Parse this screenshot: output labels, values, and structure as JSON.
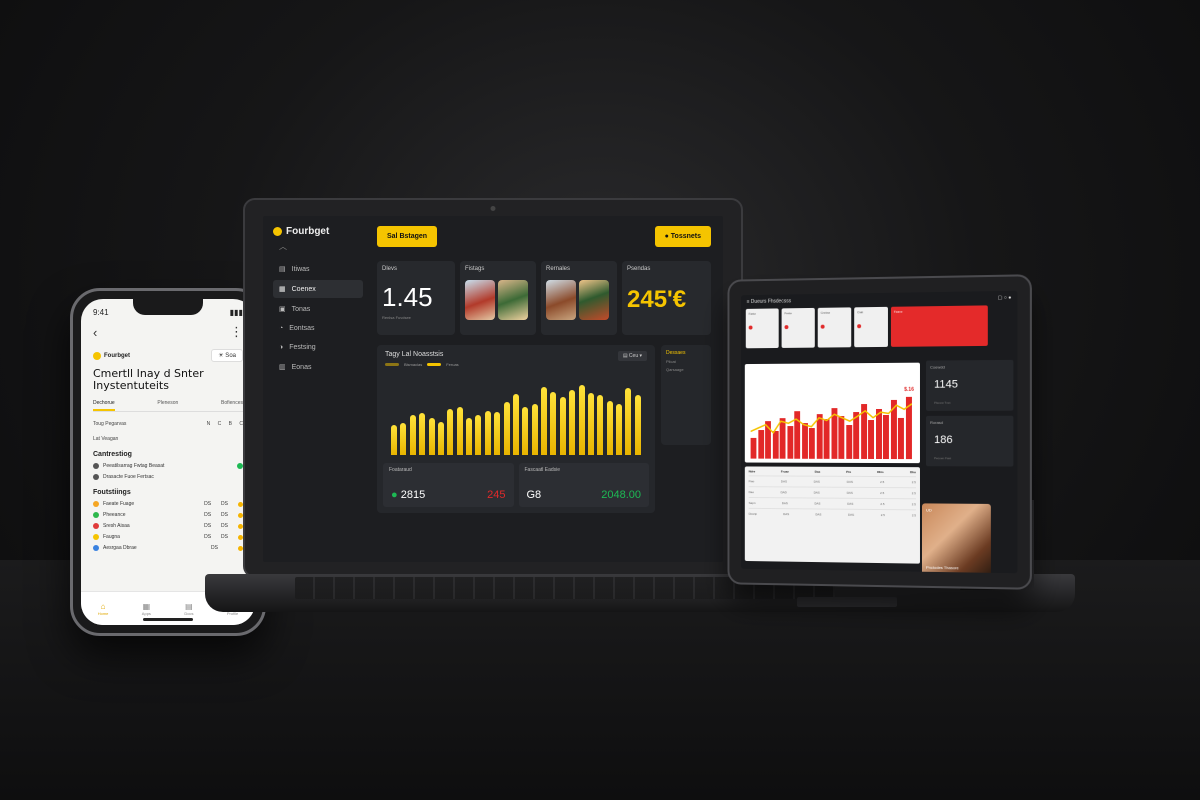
{
  "phone": {
    "status_time": "9:41",
    "back_icon": "chevron-left-icon",
    "menu_icon": "more-vertical-icon",
    "brand": "Fourbget",
    "chip": "☀ Soa",
    "title_line1": "Cmertll Inay d Snter",
    "title_line2": "Inystentuteits",
    "tabs": [
      "Dechorue",
      "Pleneson",
      "Bofiences"
    ],
    "row1_label": "Toug Pegarvas",
    "row1_icons": [
      "N",
      "C",
      "B",
      "C"
    ],
    "row2_label": "Lat  Veagan",
    "section1": "Cantrestiog",
    "section1_items": [
      {
        "label": "Peeatilsarrag  Fwtag  Beasat",
        "value": ""
      },
      {
        "label": "Drasacte  Fuoe  Fertsac",
        "value": ""
      }
    ],
    "section2": "Foutstiings",
    "section2_items": [
      {
        "label": "Faeate  Fuage",
        "v1": "DS",
        "v2": "DS",
        "color": "#f5a623"
      },
      {
        "label": "Pheeance",
        "v1": "DS",
        "v2": "DS",
        "color": "#2eb84c"
      },
      {
        "label": "Sresh  Aisaa",
        "v1": "DS",
        "v2": "DS",
        "color": "#e03a3a"
      },
      {
        "label": "Faugna",
        "v1": "DS",
        "v2": "DS",
        "color": "#f5c400"
      },
      {
        "label": "Aesrgaa  Dbrae",
        "v1": "DS",
        "v2": "",
        "color": "#3a82e0"
      }
    ],
    "bottom_nav": [
      {
        "icon": "⌂",
        "label": "Home"
      },
      {
        "icon": "▦",
        "label": "Apps"
      },
      {
        "icon": "▤",
        "label": "Docs"
      },
      {
        "icon": "♙",
        "label": "Profile"
      }
    ]
  },
  "laptop": {
    "brand": "Fourbget",
    "nav": [
      {
        "icon": "▤",
        "label": "Itiwas"
      },
      {
        "icon": "▦",
        "label": "Coenex"
      },
      {
        "icon": "▣",
        "label": "Tonas"
      },
      {
        "icon": "◔",
        "label": "Eontsas"
      },
      {
        "icon": "◑",
        "label": "Festsing"
      },
      {
        "icon": "▥",
        "label": "Eonas"
      }
    ],
    "btn_left": "Sal Bstagen",
    "btn_right": "● Tossnets",
    "card1": {
      "label": "Dlevs",
      "value": "1.45",
      "sub": "Renlsa   Fuvdsee"
    },
    "card2": {
      "label": "Fistags"
    },
    "card3": {
      "label": "Rernales"
    },
    "card4": {
      "label": "Psendas",
      "value": "245'€"
    },
    "chart_title": "Tagy Lal Noasstsis",
    "legend": [
      "Blsmacias",
      "Feruas"
    ],
    "dropdown": "▤ Ceu ▾",
    "side_panel": {
      "label": "Dessaes",
      "line1": "Plicat",
      "line2": "Qarsaage"
    },
    "stats": [
      {
        "label": "Foataraud",
        "value": "2815",
        "extra": "245",
        "color": "#1db954",
        "extra_color": "#e02a2a"
      },
      {
        "label": "Fascaatl Eadsie",
        "value": "G8",
        "extra": "2048.00",
        "color": "#ffffff",
        "extra_color": "#1db954"
      }
    ]
  },
  "laptop_chart": {
    "type": "bar",
    "values": [
      34,
      36,
      46,
      48,
      42,
      38,
      52,
      55,
      42,
      46,
      50,
      49,
      60,
      70,
      55,
      58,
      78,
      72,
      66,
      74,
      80,
      71,
      68,
      62,
      58,
      76,
      69
    ]
  },
  "tablet": {
    "header_left": "≡  Dueurs  Fhsdecsss",
    "header_right": "▢ ○ ●",
    "cards": [
      "Faste",
      "Feste",
      "Crettse",
      "Cialt"
    ],
    "red_card": "Feane",
    "chart_label": "$.16",
    "metric1": {
      "label": "Coewdd",
      "value": "1145",
      "sub": "Plsecw  Tnet"
    },
    "metric2": {
      "label": "Rorasd",
      "value": "186",
      "sub": "Pecoen  Fast"
    },
    "table_head": [
      "Ndre",
      "Fruae",
      "Daa",
      "Pra",
      "Dhis",
      "Dhu"
    ],
    "table_rows": [
      [
        "Fiao",
        "DAS",
        "DAS",
        "DAS",
        "2.5",
        "2.5"
      ],
      [
        "Dao",
        "DAD",
        "DAS",
        "DAS",
        "2.5",
        "2.5"
      ],
      [
        "Sapn",
        "DAS",
        "DAS",
        "DAS",
        "2.5",
        "2.5"
      ],
      [
        "Dcanp",
        "DAS",
        "DAS",
        "DAS",
        "2.5",
        "2.5"
      ]
    ],
    "photo_caption": "Pnctodes Thasore",
    "photo_tag": "UD"
  },
  "tablet_chart": {
    "type": "bar",
    "values": [
      30,
      42,
      55,
      40,
      60,
      48,
      70,
      52,
      45,
      66,
      58,
      74,
      62,
      50,
      68,
      80,
      56,
      72,
      64,
      85,
      60,
      90
    ],
    "line": [
      40,
      45,
      50,
      38,
      55,
      52,
      58,
      50,
      47,
      60,
      56,
      65,
      60,
      55,
      62,
      70,
      60,
      68,
      66,
      78,
      72,
      80
    ]
  }
}
